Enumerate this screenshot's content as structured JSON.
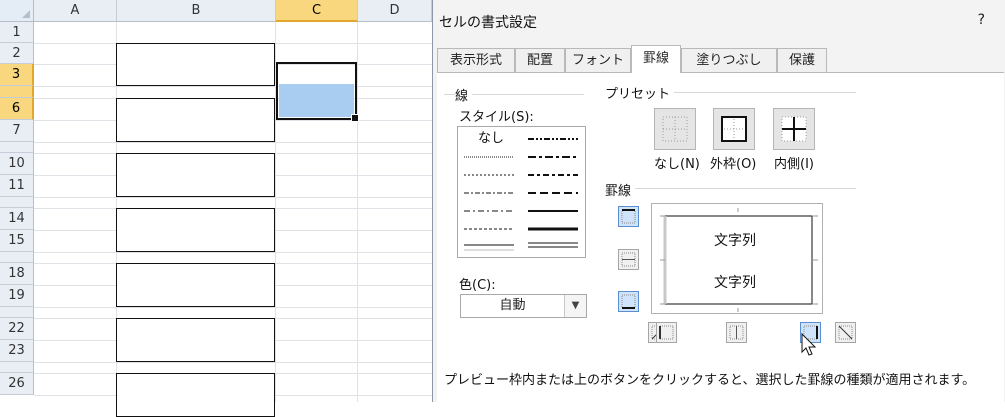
{
  "sheet": {
    "columns": [
      "A",
      "B",
      "C",
      "D"
    ],
    "rows": [
      "1",
      "2",
      "3",
      "",
      "6",
      "7",
      "",
      "10",
      "11",
      "",
      "14",
      "15",
      "",
      "18",
      "19",
      "",
      "22",
      "23",
      "",
      "26"
    ]
  },
  "dialog": {
    "title": "セルの書式設定",
    "help": "?",
    "tabs": [
      "表示形式",
      "配置",
      "フォント",
      "罫線",
      "塗りつぶし",
      "保護"
    ],
    "active_tab": "罫線",
    "line_group": "線",
    "style_label": "スタイル(S):",
    "style_none": "なし",
    "color_label": "色(C):",
    "color_value": "自動",
    "preset_group": "プリセット",
    "presets": [
      "なし(N)",
      "外枠(O)",
      "内側(I)"
    ],
    "border_group": "罫線",
    "preview_text_top": "文字列",
    "preview_text_bottom": "文字列",
    "hint": "プレビュー枠内または上のボタンをクリックすると、選択した罫線の種類が適用されます。"
  },
  "colors": {
    "selected_header": "#f9d77e",
    "selection_fill": "#a8cdf0",
    "toggle_on": "#cfe3fb"
  }
}
